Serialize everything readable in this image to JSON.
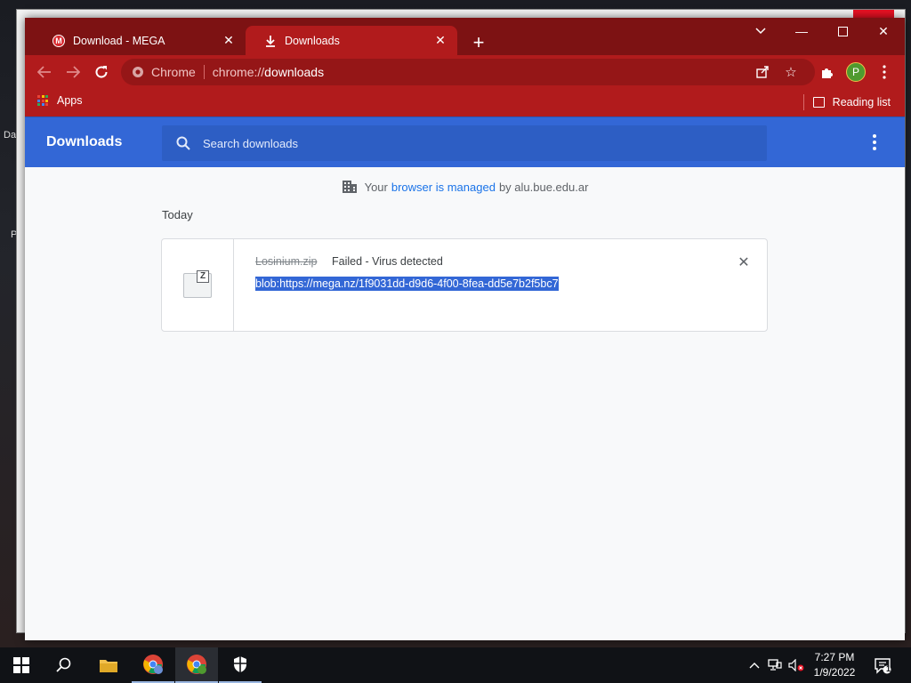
{
  "desktop": {
    "icon_fragments": [
      "Da",
      "P"
    ]
  },
  "tabs": [
    {
      "title": "Download - MEGA",
      "favicon": "mega-icon",
      "active": false
    },
    {
      "title": "Downloads",
      "favicon": "download-icon",
      "active": true
    }
  ],
  "toolbar": {
    "omnibox_chip": "Chrome",
    "url_scheme": "chrome://",
    "url_host": "downloads",
    "avatar_letter": "P"
  },
  "bookmarks": {
    "apps_label": "Apps",
    "reading_list_label": "Reading list"
  },
  "downloads": {
    "title": "Downloads",
    "search_placeholder": "Search downloads",
    "managed_prefix": "Your",
    "managed_link": "browser is managed",
    "managed_suffix": "by alu.bue.edu.ar",
    "section_today": "Today",
    "item": {
      "file_name": "Losinium.zip",
      "status": "Failed - Virus detected",
      "url": "blob:https://mega.nz/1f9031dd-d9d6-4f00-8fea-dd5e7b2f5bc7",
      "icon_letter": "Z"
    }
  },
  "taskbar": {
    "time": "7:27 PM",
    "date": "1/9/2022",
    "notification_count": "1"
  },
  "colors": {
    "titlebar": "#7d1213",
    "toolbar": "#b11b1c",
    "header": "#3367d6",
    "selection": "#3367d6"
  }
}
